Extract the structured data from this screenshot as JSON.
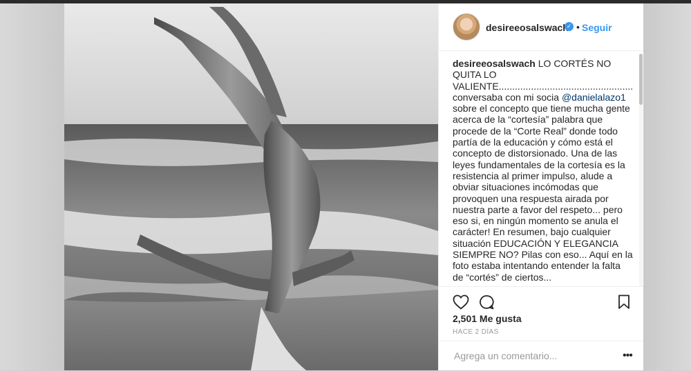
{
  "post": {
    "username": "desireeosalswach",
    "follow_label": "Seguir",
    "separator": "•",
    "verified_icon": "verified-badge-icon",
    "photo_description_icon": "photo",
    "caption": {
      "username": "desireeosalswach",
      "part1": "LO CORTÉS NO QUITA LO VALIENTE.............................................................................Ayer conversaba con mi socia ",
      "mention": "@danielalazo1",
      "part2": " sobre el concepto que tiene mucha gente acerca de la “cortesía” palabra que procede de la “Corte Real” donde todo partía de la educación y cómo está el concepto de distorsionado. Una de las leyes fundamentales de la cortesía es la resistencia al primer impulso, alude a obviar situaciones incómodas que provoquen una respuesta airada por nuestra parte a favor del respeto... pero eso si, en ningún momento se anula el carácter! En resumen, bajo cualquier situación EDUCACIÓN Y ELEGANCIA SIEMPRE NO? Pilas con eso... Aquí en la foto estaba intentando entender la falta de “cortés” de ciertos..."
    },
    "likes_label": "2,501 Me gusta",
    "time_label": "HACE 2 DÍAS",
    "comment_placeholder": "Agrega un comentario...",
    "more_label": "•••"
  },
  "icons": {
    "like": "heart-icon",
    "comment": "comment-icon",
    "save": "bookmark-icon"
  },
  "colors": {
    "accent": "#3897f0",
    "text": "#262626",
    "muted": "#999999",
    "mention": "#003569"
  }
}
